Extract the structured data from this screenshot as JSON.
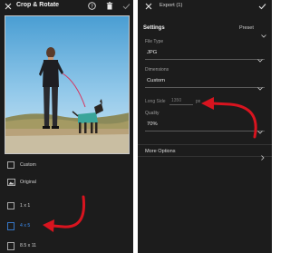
{
  "crop_screen": {
    "title": "Crop & Rotate",
    "icons": [
      "close-icon",
      "help-icon",
      "delete-icon",
      "checkmark-icon"
    ],
    "aspect_ratios": [
      {
        "label": "Custom",
        "icon": "custom-crop-icon",
        "selected": false
      },
      {
        "label": "Original",
        "icon": "original-image-icon",
        "selected": false
      },
      {
        "label": "1 x 1",
        "icon": "square-ratio-icon",
        "selected": false
      },
      {
        "label": "4 x 5",
        "icon": "portrait-ratio-icon",
        "selected": true
      },
      {
        "label": "8.5 x 11",
        "icon": "letter-ratio-icon",
        "selected": false
      }
    ]
  },
  "export_screen": {
    "title": "Export (1)",
    "icons": [
      "close-icon",
      "checkmark-icon"
    ],
    "section_title": "Settings",
    "preset_label": "Preset",
    "file_type": {
      "label": "File Type",
      "value": "JPG"
    },
    "dimensions": {
      "label": "Dimensions",
      "value": "Custom"
    },
    "long_side": {
      "label": "Long Side",
      "placeholder": "1350",
      "unit": "px"
    },
    "quality": {
      "label": "Quality",
      "value": "70%"
    },
    "more_options": "More Options"
  },
  "colors": {
    "panel_bg": "#1c1c1c",
    "accent_blue": "#3d8ef0",
    "annotation_red": "#d8141f"
  }
}
